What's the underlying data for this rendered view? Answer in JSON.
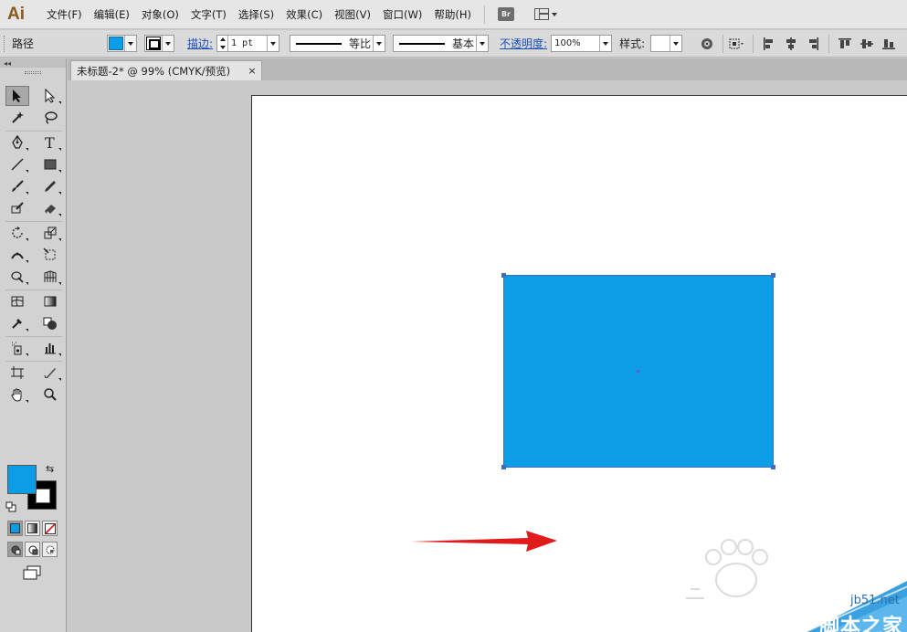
{
  "app": {
    "logo": "Ai",
    "menus": [
      "文件(F)",
      "编辑(E)",
      "对象(O)",
      "文字(T)",
      "选择(S)",
      "效果(C)",
      "视图(V)",
      "窗口(W)",
      "帮助(H)"
    ],
    "bridge_label": "Br"
  },
  "control_bar": {
    "selection_label": "路径",
    "fill_color": "#0b9de6",
    "stroke_label": "描边:",
    "stroke_weight": "1 pt",
    "profile_label": "等比",
    "brush_label": "基本",
    "opacity_label": "不透明度:",
    "opacity_value": "100%",
    "style_label": "样式:"
  },
  "document": {
    "tab_title": "未标题-2* @ 99% (CMYK/预览)",
    "close_glyph": "×"
  },
  "tools": {
    "collapse_glyph": "◂◂",
    "fill_color": "#0b9de6",
    "stroke_color": "#000000"
  },
  "canvas": {
    "shape_color": "#0b9de6",
    "arrow_color": "#e11b1b"
  },
  "watermark": {
    "site": "jb51.net",
    "name": "脚本之家"
  }
}
